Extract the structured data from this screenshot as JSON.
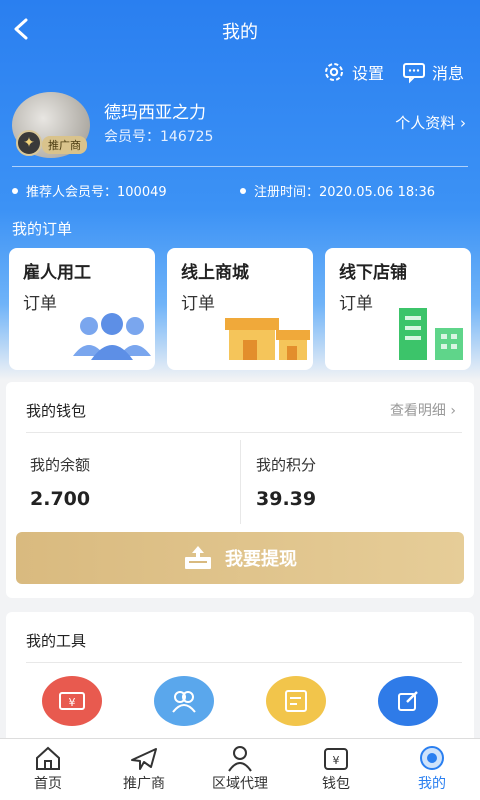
{
  "header": {
    "title": "我的"
  },
  "toplinks": {
    "settings": "设置",
    "messages": "消息"
  },
  "user": {
    "name": "德玛西亚之力",
    "member_label": "会员号：",
    "member_no": "146725",
    "badge": "推广商",
    "profile_link": "个人资料",
    "referrer_label": "推荐人会员号：",
    "referrer_no": "100049",
    "register_label": "注册时间：",
    "register_time": "2020.05.06 18:36"
  },
  "orders": {
    "title": "我的订单",
    "cards": [
      {
        "line1": "雇人用工",
        "line2": "订单"
      },
      {
        "line1": "线上商城",
        "line2": "订单"
      },
      {
        "line1": "线下店铺",
        "line2": "订单"
      }
    ]
  },
  "wallet": {
    "title": "我的钱包",
    "detail": "查看明细",
    "balance_label": "我的余额",
    "balance": "2.700",
    "points_label": "我的积分",
    "points": "39.39",
    "withdraw": "我要提现"
  },
  "tools": {
    "title": "我的工具"
  },
  "tabs": [
    {
      "label": "首页"
    },
    {
      "label": "推广商"
    },
    {
      "label": "区域代理"
    },
    {
      "label": "钱包"
    },
    {
      "label": "我的"
    }
  ],
  "colors": {
    "primary": "#2a7ff0",
    "gold": "#d9ba7f"
  }
}
